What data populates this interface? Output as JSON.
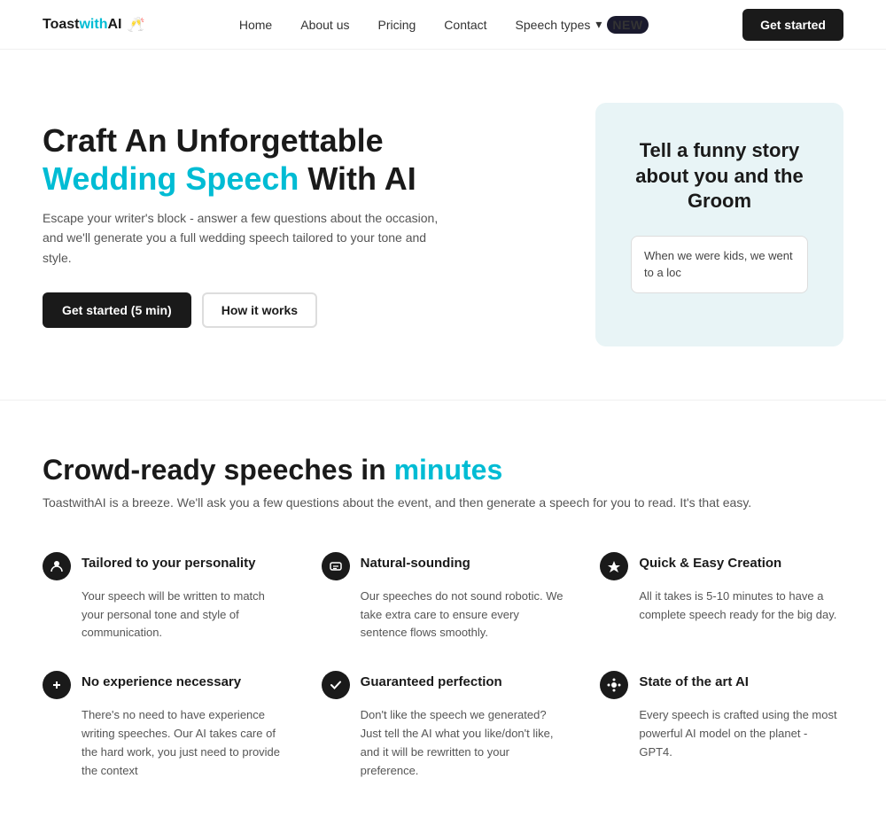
{
  "nav": {
    "logo_text_1": "Toast",
    "logo_text_highlight": "with",
    "logo_text_2": "AI",
    "logo_icon": "🥂",
    "links": [
      {
        "label": "Home",
        "id": "home"
      },
      {
        "label": "About us",
        "id": "about"
      },
      {
        "label": "Pricing",
        "id": "pricing"
      },
      {
        "label": "Contact",
        "id": "contact"
      }
    ],
    "speech_types_label": "Speech types",
    "new_badge": "NEW",
    "cta_label": "Get started"
  },
  "hero": {
    "title_line1": "Craft An Unforgettable",
    "title_highlight": "Wedding Speech",
    "title_line2": "With AI",
    "description": "Escape your writer's block - answer a few questions about the occasion, and we'll generate you a full wedding speech tailored to your tone and style.",
    "btn_primary": "Get started (5 min)",
    "btn_secondary": "How it works",
    "card_title": "Tell a funny story about you and the Groom",
    "card_input_placeholder": "When we were kids, we went to a loc"
  },
  "features": {
    "headline_1": "Crowd-ready speeches in ",
    "headline_highlight": "minutes",
    "subtext": "ToastwithAI is a breeze. We'll ask you a few questions about the event, and then generate a speech for you to read. It's that easy.",
    "items": [
      {
        "icon": "👤",
        "title": "Tailored to your personality",
        "description": "Your speech will be written to match your personal tone and style of communication."
      },
      {
        "icon": "🔊",
        "title": "Natural-sounding",
        "description": "Our speeches do not sound robotic. We take extra care to ensure every sentence flows smoothly."
      },
      {
        "icon": "⚡",
        "title": "Quick & Easy Creation",
        "description": "All it takes is 5-10 minutes to have a complete speech ready for the big day."
      },
      {
        "icon": "✏️",
        "title": "No experience necessary",
        "description": "There's no need to have experience writing speeches. Our AI takes care of the hard work, you just need to provide the context"
      },
      {
        "icon": "✔️",
        "title": "Guaranteed perfection",
        "description": "Don't like the speech we generated? Just tell the AI what you like/don't like, and it will be rewritten to your preference."
      },
      {
        "icon": "🔬",
        "title": "State of the art AI",
        "description": "Every speech is crafted using the most powerful AI model on the planet - GPT4."
      }
    ]
  }
}
